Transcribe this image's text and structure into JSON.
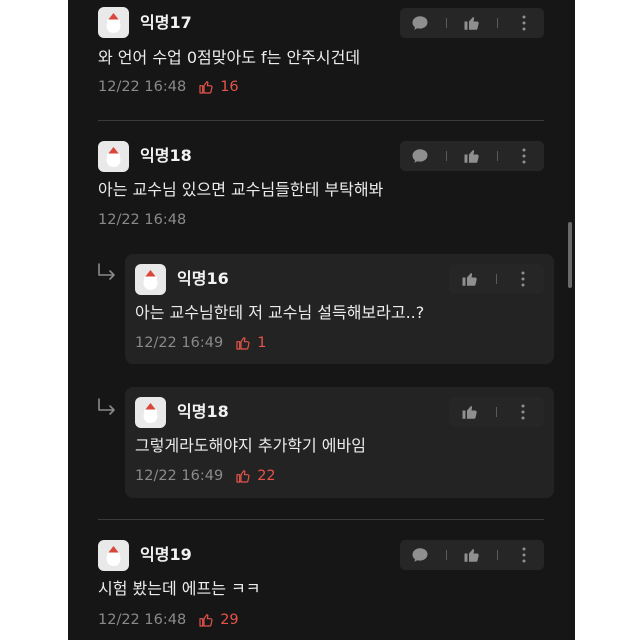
{
  "comments": [
    {
      "nickname": "익명17",
      "text": "와 언어 수업 0점맞아도 f는 안주시건데",
      "time": "12/22 16:48",
      "likes": "16"
    },
    {
      "nickname": "익명18",
      "text": "아는 교수님 있으면 교수님들한테 부탁해봐",
      "time": "12/22 16:48",
      "likes": ""
    },
    {
      "nickname": "익명19",
      "text": "시험 봤는데 에프는 ㅋㅋ",
      "time": "12/22 16:48",
      "likes": "29"
    }
  ],
  "replies": [
    {
      "nickname": "익명16",
      "text": "아는 교수님한테 저 교수님 설득해보라고..?",
      "time": "12/22 16:49",
      "likes": "1"
    },
    {
      "nickname": "익명18",
      "text": "그렇게라도해야지 추가학기 에바임",
      "time": "12/22 16:49",
      "likes": "22"
    }
  ],
  "icons": {
    "reply": "speech-bubble-icon",
    "like": "thumbs-up-icon",
    "more": "more-vertical-icon",
    "reply_indicator": "reply-arrow-icon"
  },
  "colors": {
    "background": "#161616",
    "like_accent": "#e5534b",
    "meta_gray": "#8a8a8a",
    "reply_box": "#232323"
  }
}
